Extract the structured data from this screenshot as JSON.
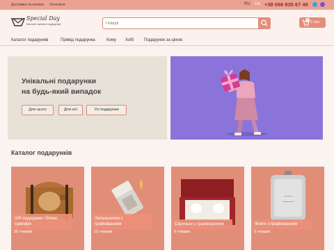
{
  "topbar": {
    "links": [
      "Доставка та оплата",
      "Контакти"
    ],
    "langs": [
      "RU",
      "UA"
    ],
    "active_lang": "UA",
    "phone": "+38 066 835 67 40",
    "social": [
      {
        "icon": "telegram-icon",
        "color": "#2fa7e0"
      },
      {
        "icon": "viber-icon",
        "color": "#7b4fcf"
      }
    ]
  },
  "logo": {
    "name": "Special Day",
    "tagline": "Магазин змінних подарунків"
  },
  "search": {
    "placeholder": "Пошук"
  },
  "cart": {
    "count": "0",
    "total": "0 грн."
  },
  "nav": [
    "Каталог подарунків",
    "Привід подарунка",
    "Кому",
    "Хобі",
    "Подарунок за ціною"
  ],
  "hero": {
    "title_line1": "Унікальні подарунки",
    "title_line2": "на будь-який випадок",
    "buttons": [
      "Для нього",
      "Для неї",
      "Усі подарунки"
    ]
  },
  "catalog": {
    "title": "Каталог подарунків",
    "cards": [
      {
        "label": "VIP-подарунки і бізнес сувеніри",
        "count": "30 товарів"
      },
      {
        "label": "Запальнички з гравіюванням",
        "count": "15 товарів"
      },
      {
        "label": "Скриньки з гравіюванням",
        "count": "6 товарів"
      },
      {
        "label": "Фляги з гравіюванням",
        "count": "5 товарів"
      }
    ]
  },
  "colors": {
    "accent": "#e38e7a",
    "topbar": "#eba292",
    "page": "#fbf3ef",
    "hero_bg": "#8a74da",
    "hero_left": "#e8e1d8"
  }
}
